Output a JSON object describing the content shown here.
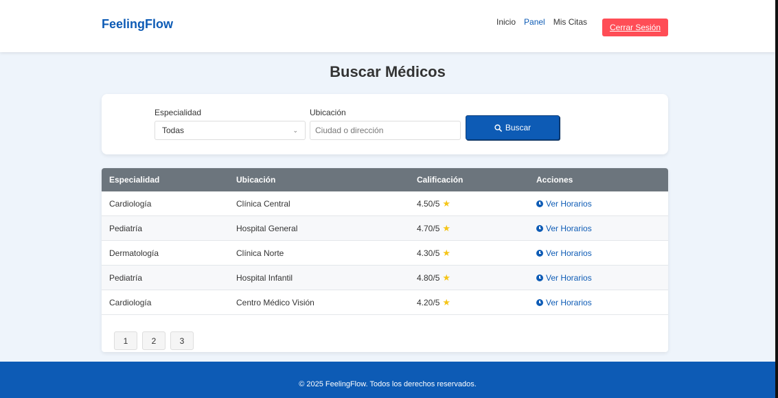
{
  "header": {
    "brand": "FeelingFlow",
    "nav": [
      {
        "label": "Inicio",
        "active": false
      },
      {
        "label": "Panel",
        "active": true
      },
      {
        "label": "Mis Citas",
        "active": false
      }
    ],
    "logout_label": "Cerrar Sesión"
  },
  "page": {
    "title": "Buscar Médicos"
  },
  "search": {
    "specialty_label": "Especialidad",
    "specialty_value": "Todas",
    "location_label": "Ubicación",
    "location_placeholder": "Ciudad o dirección",
    "button_label": "Buscar"
  },
  "table": {
    "headers": [
      "Especialidad",
      "Ubicación",
      "Calificación",
      "Acciones"
    ],
    "rows": [
      {
        "specialty": "Cardiología",
        "location": "Clínica Central",
        "rating": "4.50/5",
        "action": "Ver Horarios"
      },
      {
        "specialty": "Pediatría",
        "location": "Hospital General",
        "rating": "4.70/5",
        "action": "Ver Horarios"
      },
      {
        "specialty": "Dermatología",
        "location": "Clínica Norte",
        "rating": "4.30/5",
        "action": "Ver Horarios"
      },
      {
        "specialty": "Pediatría",
        "location": "Hospital Infantil",
        "rating": "4.80/5",
        "action": "Ver Horarios"
      },
      {
        "specialty": "Cardiología",
        "location": "Centro Médico Visión",
        "rating": "4.20/5",
        "action": "Ver Horarios"
      }
    ]
  },
  "pagination": [
    "1",
    "2",
    "3"
  ],
  "footer": {
    "text": "© 2025 FeelingFlow. Todos los derechos reservados."
  },
  "colors": {
    "brand": "#0d5bb5",
    "logout": "#ff4d56",
    "table_header": "#6c757d",
    "star": "#f5c518",
    "background": "#eef4fb"
  },
  "icons": {
    "search": "search-icon",
    "star": "star-icon",
    "clock": "clock-icon",
    "chevron": "chevron-down-icon"
  }
}
